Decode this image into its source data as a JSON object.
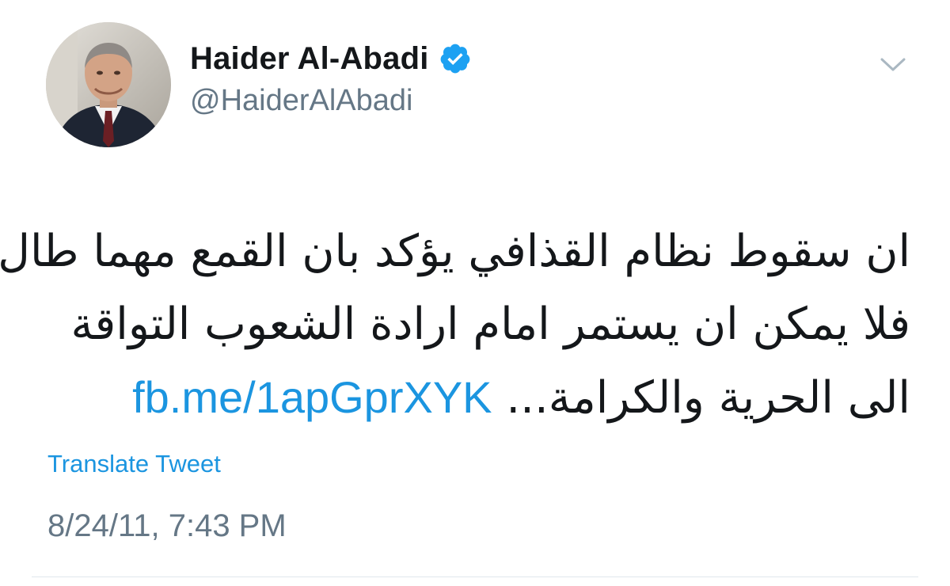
{
  "author": {
    "display_name": "Haider Al-Abadi",
    "handle": "@HaiderAlAbadi",
    "verified": true,
    "avatar_icon": "profile-photo"
  },
  "header": {
    "menu_icon": "chevron-down-icon"
  },
  "tweet": {
    "lines": [
      "ان سقوط نظام القذافي يؤكد بان القمع مهما طال",
      "فلا يمكن ان يستمر امام ارادة الشعوب التواقة",
      "الى الحرية والكرامة..."
    ],
    "link": "fb.me/1apGprXYK",
    "translate_label": "Translate Tweet",
    "timestamp": "8/24/11, 7:43 PM"
  },
  "colors": {
    "link": "#1b95e0",
    "verified_badge": "#1da1f2",
    "text": "#14171a",
    "muted": "#657786"
  }
}
